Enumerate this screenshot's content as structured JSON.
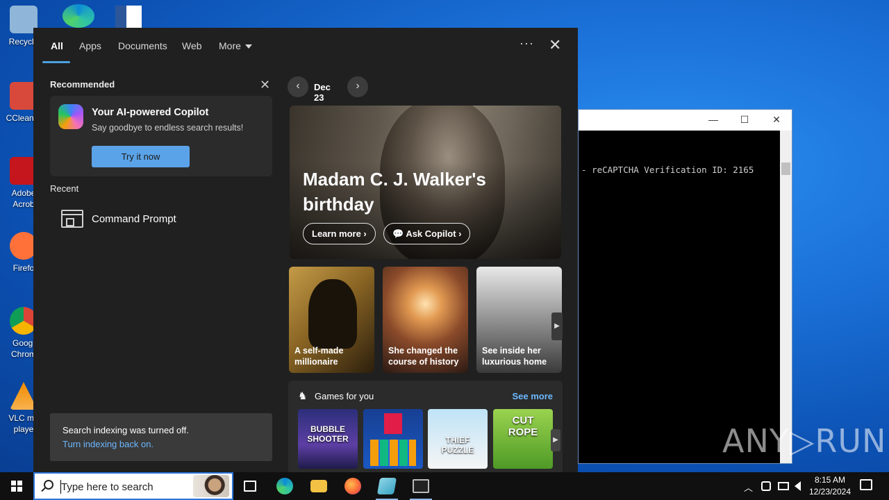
{
  "desktop": {
    "icons": [
      {
        "label": "Recycle",
        "color": "#8fb6d8"
      },
      {
        "label": "CCleaner",
        "color": "#d8493c"
      },
      {
        "label": "Adobe\nAcrob",
        "color": "#c4161c"
      },
      {
        "label": "Firefo",
        "color": "#ff7139"
      },
      {
        "label": "Googl\nChrom",
        "color": "#2f9e44"
      },
      {
        "label": "VLC me\nplaye",
        "color": "#f08a00"
      }
    ]
  },
  "cmd_window": {
    "minimize": "—",
    "maximize": "☐",
    "close": "✕",
    "text": "- reCAPTCHA Verification ID: 2165"
  },
  "watermark": "ANY▷RUN",
  "search_panel": {
    "tabs": [
      "All",
      "Apps",
      "Documents",
      "Web",
      "More"
    ],
    "more_dots": "···",
    "close": "✕",
    "recommended": {
      "heading": "Recommended",
      "close": "✕",
      "card": {
        "title": "Your AI-powered Copilot",
        "subtitle": "Say goodbye to endless search results!",
        "button": "Try it now"
      }
    },
    "recent": {
      "heading": "Recent",
      "items": [
        {
          "label": "Command Prompt"
        }
      ]
    },
    "indexing": {
      "line1": "Search indexing was turned off.",
      "line2": "Turn indexing back on."
    },
    "date_nav": {
      "prev": "‹",
      "label": "Dec 23",
      "next": "›"
    },
    "hero": {
      "title": "Madam C. J. Walker's birthday",
      "learn_more": "Learn more  ›",
      "ask_copilot": "💬 Ask Copilot  ›"
    },
    "cards": [
      {
        "caption": "A self-made\nmillionaire"
      },
      {
        "caption": "She changed the\ncourse of history"
      },
      {
        "caption": "See inside her\nluxurious home"
      }
    ],
    "card_arrow": "▶",
    "games": {
      "heading": "Games for you",
      "see_more": "See more",
      "arrow": "▶",
      "items": [
        {
          "title": "BUBBLE\nSHOOTER"
        },
        {
          "title": ""
        },
        {
          "title": "THIEF\nPUZZLE"
        },
        {
          "title": "CUT\nROPE"
        }
      ]
    }
  },
  "taskbar": {
    "search_placeholder": "Type here to search",
    "tray_chevron": "︿",
    "time": "8:15 AM",
    "date": "12/23/2024"
  }
}
